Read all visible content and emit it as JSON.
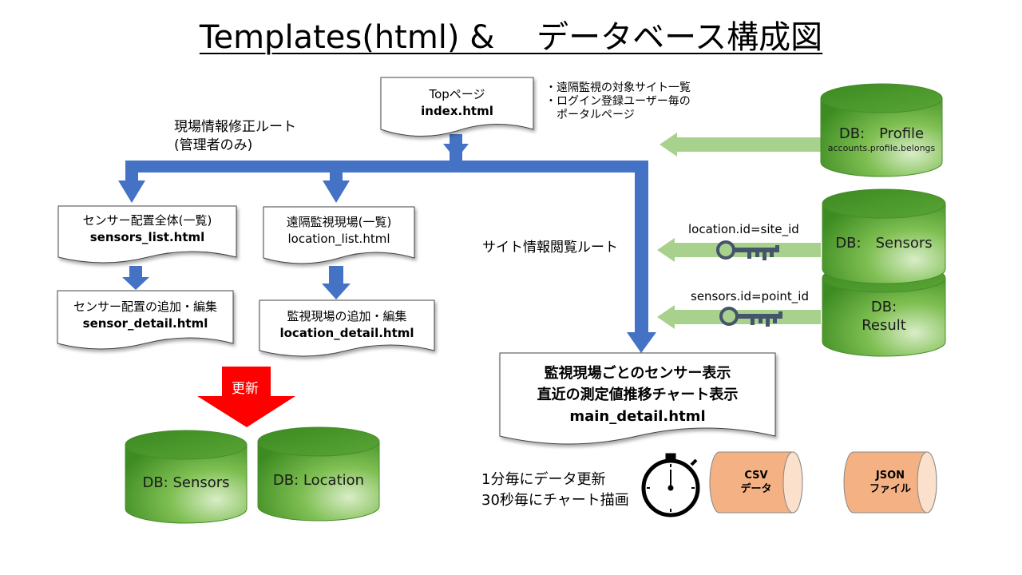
{
  "title": "Templates(html) & 　データベース構成図",
  "top_doc": {
    "line1": "Topページ",
    "line2": "index.html"
  },
  "top_notes": [
    "・遠隔監視の対象サイト一覧",
    "・ログイン登録ユーザー毎の",
    "　ポータルページ"
  ],
  "admin_route": {
    "line1": "現場情報修正ルート",
    "line2": "(管理者のみ)"
  },
  "site_route": "サイト情報閲覧ルート",
  "sensors_list": {
    "line1": "センサー配置全体(一覧)",
    "line2": "sensors_list.html"
  },
  "location_list": {
    "line1": "遠隔監視現場(一覧)",
    "line2": "location_list.html"
  },
  "sensor_detail": {
    "line1": "センサー配置の追加・編集",
    "line2": "sensor_detail.html"
  },
  "location_detail": {
    "line1": "監視現場の追加・編集",
    "line2": "location_detail.html"
  },
  "main_detail": {
    "line1": "監視現場ごとのセンサー表示",
    "line2": "直近の測定値推移チャート表示",
    "line3": "main_detail.html"
  },
  "update_label": "更新",
  "db_profile": {
    "line1": "DB:　Profile",
    "line2": "accounts.profile.belongs"
  },
  "db_sensors_right": "DB:　Sensors",
  "db_result": {
    "line1": "DB:",
    "line2": "Result"
  },
  "key_location": "location.id=site_id",
  "key_sensors": "sensors.id=point_id",
  "db_sensors_bottom": "DB: Sensors",
  "db_location_bottom": "DB: Location",
  "update_timing": [
    "1分毎にデータ更新",
    "30秒毎にチャート描画"
  ],
  "csv_file": {
    "line1": "CSV",
    "line2": "データ"
  },
  "json_file": {
    "line1": "JSON",
    "line2": "ファイル"
  },
  "colors": {
    "blue_arrow": "#4472c4",
    "light_green": "#a9d18e",
    "db_green": "#3f8f2a",
    "red": "#ff0000",
    "orange": "#f4b183",
    "key_blue": "#44546a"
  }
}
